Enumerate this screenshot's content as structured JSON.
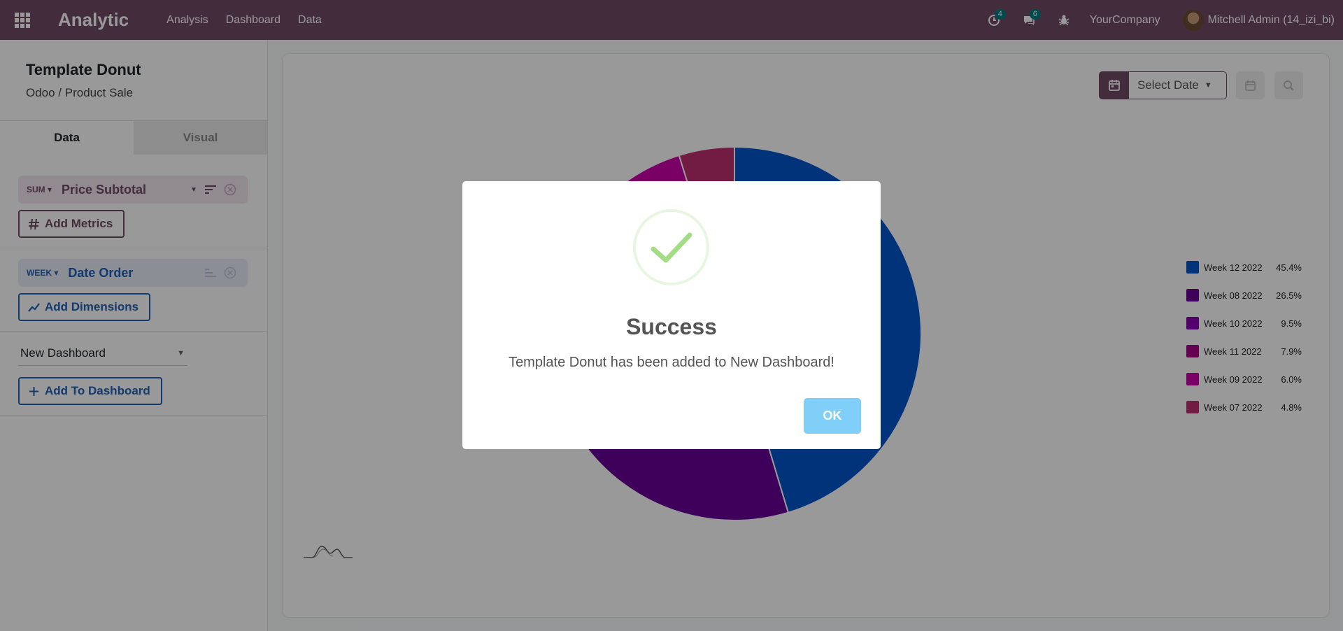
{
  "navbar": {
    "brand": "Analytic",
    "menu": [
      "Analysis",
      "Dashboard",
      "Data"
    ],
    "activities_count": "4",
    "messages_count": "6",
    "company": "YourCompany",
    "user": "Mitchell Admin (14_izi_bi)",
    "background_color": "#714B67"
  },
  "sidebar": {
    "title": "Template Donut",
    "subtitle": "Odoo / Product Sale",
    "tabs": [
      "Data",
      "Visual"
    ],
    "metric": {
      "aggregation": "SUM",
      "field": "Price Subtotal"
    },
    "add_metrics_label": "Add Metrics",
    "dimension": {
      "aggregation": "WEEK",
      "field": "Date Order"
    },
    "add_dimensions_label": "Add Dimensions",
    "dashboard_select": "New Dashboard",
    "add_to_dashboard_label": "Add To Dashboard"
  },
  "toolbar": {
    "date_placeholder": "Select Date"
  },
  "chart_data": {
    "type": "pie",
    "categories": [
      "Week 12 2022",
      "Week 08 2022",
      "Week 10 2022",
      "Week 11 2022",
      "Week 09 2022",
      "Week 07 2022"
    ],
    "values": [
      45.4,
      26.5,
      9.5,
      7.9,
      6.0,
      4.8
    ],
    "value_labels": [
      "45.4%",
      "26.5%",
      "9.5%",
      "7.9%",
      "6.0%",
      "4.8%"
    ],
    "colors": [
      "#0055cc",
      "#6a0099",
      "#8b00b8",
      "#aa0088",
      "#cc00aa",
      "#bf3070"
    ],
    "legend_position": "right"
  },
  "modal": {
    "icon": "success-check-icon",
    "title": "Success",
    "text": "Template Donut has been added to New Dashboard!",
    "ok_label": "OK"
  }
}
